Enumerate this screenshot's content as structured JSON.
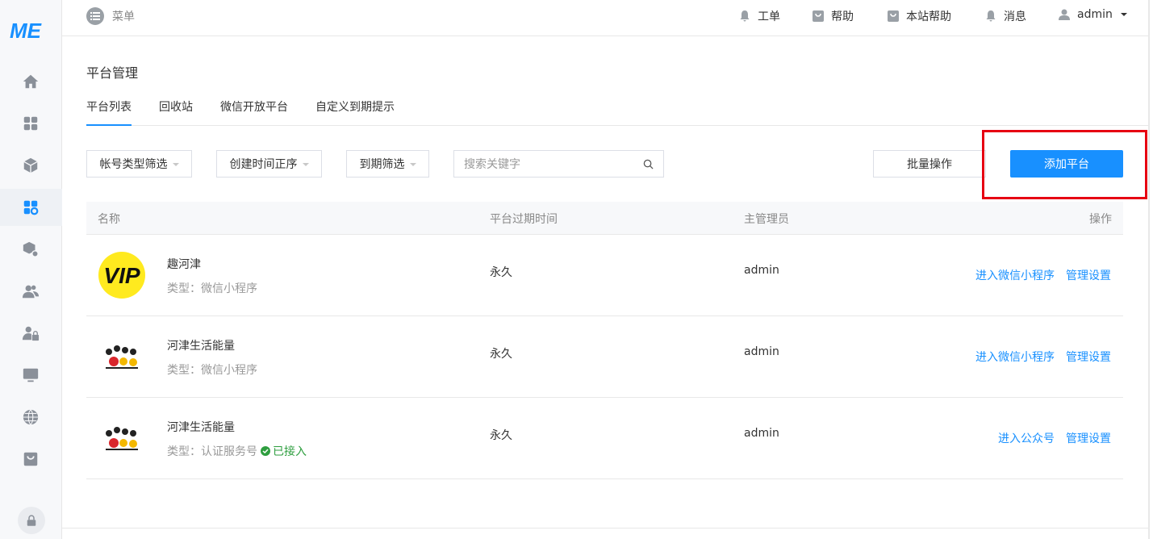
{
  "colors": {
    "accent": "#1890ff",
    "highlight": "#e60012",
    "success": "#2e9e3f"
  },
  "logo": {
    "text": "ME"
  },
  "sidebar": {
    "items": [
      {
        "icon": "home-icon"
      },
      {
        "icon": "apps-grid-icon"
      },
      {
        "icon": "cube-icon"
      },
      {
        "icon": "platform-settings-icon",
        "active": true
      },
      {
        "icon": "module-settings-icon"
      },
      {
        "icon": "users-icon"
      },
      {
        "icon": "user-lock-icon"
      },
      {
        "icon": "monitor-icon"
      },
      {
        "icon": "globe-icon"
      },
      {
        "icon": "store-bag-icon"
      }
    ],
    "lock_icon": "lock-icon"
  },
  "topbar": {
    "menu_label": "菜单",
    "items": [
      {
        "label": "工单",
        "icon": "bell-icon"
      },
      {
        "label": "帮助",
        "icon": "bag-icon"
      },
      {
        "label": "本站帮助",
        "icon": "bag-icon"
      },
      {
        "label": "消息",
        "icon": "bell-icon"
      }
    ],
    "user": "admin"
  },
  "page": {
    "title": "平台管理",
    "tabs": [
      {
        "label": "平台列表",
        "active": true
      },
      {
        "label": "回收站"
      },
      {
        "label": "微信开放平台"
      },
      {
        "label": "自定义到期提示"
      }
    ]
  },
  "filters": {
    "account_type": "帐号类型筛选",
    "create_time": "创建时间正序",
    "expire": "到期筛选",
    "search_placeholder": "搜索关键字",
    "batch": "批量操作",
    "add": "添加平台"
  },
  "table": {
    "headers": {
      "name": "名称",
      "expire": "平台过期时间",
      "admin": "主管理员",
      "ops": "操作"
    },
    "rows": [
      {
        "name": "趣河津",
        "type": "类型：微信小程序",
        "expire": "永久",
        "admin": "admin",
        "op1": "进入微信小程序",
        "op2": "管理设置",
        "avatar": "vip-logo",
        "avatar_text": "VIP"
      },
      {
        "name": "河津生活能量",
        "type": "类型：微信小程序",
        "expire": "永久",
        "admin": "admin",
        "op1": "进入微信小程序",
        "op2": "管理设置",
        "avatar": "cartoon-logo"
      },
      {
        "name": "河津生活能量",
        "type": "类型：认证服务号",
        "connected": "已接入",
        "expire": "永久",
        "admin": "admin",
        "op1": "进入公众号",
        "op2": "管理设置",
        "avatar": "cartoon-logo"
      }
    ]
  }
}
